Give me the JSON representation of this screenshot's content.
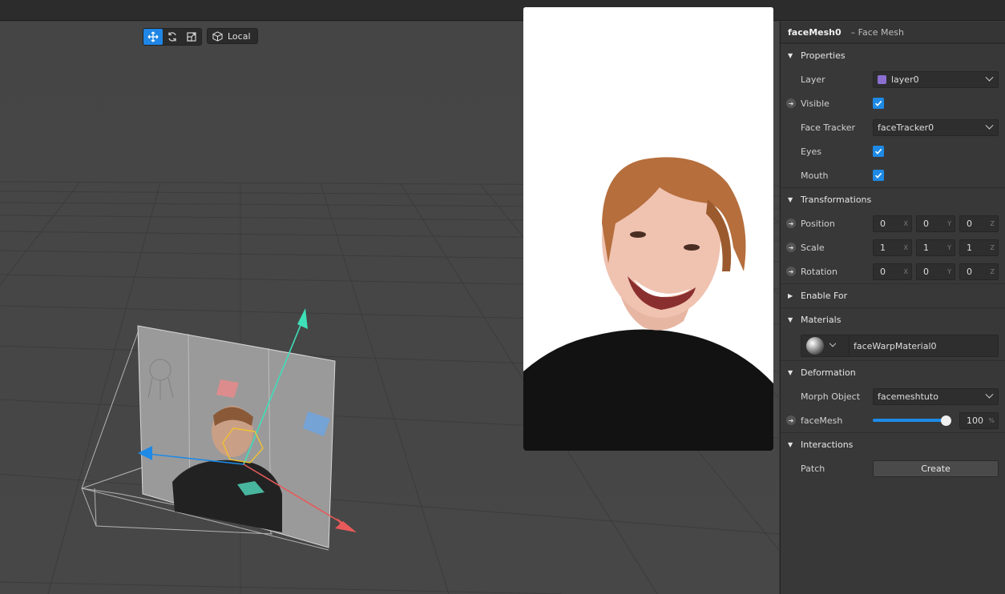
{
  "toolbar": {
    "tools": [
      {
        "icon": "move-icon",
        "active": true
      },
      {
        "icon": "rotate-icon",
        "active": false
      },
      {
        "icon": "scale-icon",
        "active": false
      }
    ],
    "space_label": "Local",
    "space_icon": "cube-icon"
  },
  "inspector": {
    "object_name": "faceMesh0",
    "object_type": "– Face Mesh",
    "sections": {
      "properties": "Properties",
      "transformations": "Transformations",
      "enable_for": "Enable For",
      "materials": "Materials",
      "deformation": "Deformation",
      "interactions": "Interactions"
    },
    "layer": {
      "label": "Layer",
      "value": "layer0",
      "color": "#8a6fd1"
    },
    "visible": {
      "label": "Visible",
      "checked": true
    },
    "face_tracker": {
      "label": "Face Tracker",
      "value": "faceTracker0"
    },
    "eyes": {
      "label": "Eyes",
      "checked": true
    },
    "mouth": {
      "label": "Mouth",
      "checked": true
    },
    "position": {
      "label": "Position",
      "x": "0",
      "y": "0",
      "z": "0"
    },
    "scale": {
      "label": "Scale",
      "x": "1",
      "y": "1",
      "z": "1"
    },
    "rotation": {
      "label": "Rotation",
      "x": "0",
      "y": "0",
      "z": "0"
    },
    "axes": {
      "x": "X",
      "y": "Y",
      "z": "Z"
    },
    "material": {
      "name": "faceWarpMaterial0"
    },
    "morph_object": {
      "label": "Morph Object",
      "value": "facemeshtuto"
    },
    "face_mesh_slider": {
      "label": "faceMesh",
      "value": "100",
      "unit": "%",
      "fraction": 1.0
    },
    "patch": {
      "label": "Patch",
      "button": "Create"
    }
  },
  "colors": {
    "accent": "#1e8ae6",
    "axis_x": "#e85a5a",
    "axis_y": "#3ee0b8",
    "axis_z": "#1e8ae6"
  }
}
